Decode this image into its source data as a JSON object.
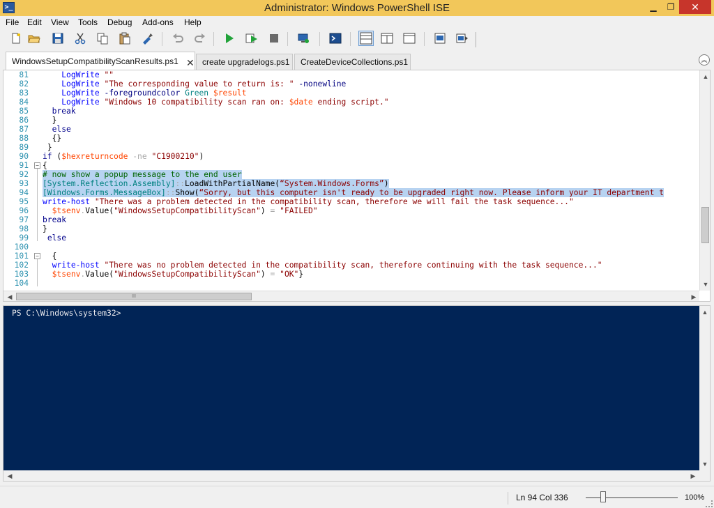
{
  "window": {
    "title": "Administrator: Windows PowerShell ISE",
    "icon_name": "powershell-icon",
    "min_glyph": "▁",
    "max_glyph": "❐",
    "close_glyph": "✕"
  },
  "menu": [
    "File",
    "Edit",
    "View",
    "Tools",
    "Debug",
    "Add-ons",
    "Help"
  ],
  "toolbar_icons": [
    "new-file-icon",
    "open-folder-icon",
    "save-icon",
    "cut-icon",
    "copy-icon",
    "paste-icon",
    "clear-console-icon",
    "undo-icon",
    "redo-icon",
    "run-script-icon",
    "run-selection-icon",
    "stop-icon",
    "remote-powershell-icon",
    "powershell-console-icon",
    "show-script-top-icon",
    "show-script-right-icon",
    "show-script-maximized-icon",
    "commands-addon-icon",
    "show-command-window-icon"
  ],
  "tabs": [
    {
      "label": "WindowsSetupCompatibilityScanResults.ps1",
      "active": true,
      "close": "✕"
    },
    {
      "label": "create upgradelogs.ps1",
      "active": false
    },
    {
      "label": "CreateDeviceCollections.ps1",
      "active": false
    }
  ],
  "collapse_glyph": "︽",
  "editor": {
    "lines": [
      {
        "n": "81",
        "indent": "    ",
        "tokens": [
          [
            "cmd",
            "LogWrite"
          ],
          [
            "txt",
            " "
          ],
          [
            "str",
            "\"\""
          ]
        ]
      },
      {
        "n": "82",
        "indent": "    ",
        "tokens": [
          [
            "cmd",
            "LogWrite"
          ],
          [
            "txt",
            " "
          ],
          [
            "str",
            "\"The corresponding value to return is: \""
          ],
          [
            "txt",
            " "
          ],
          [
            "param",
            "-nonewline"
          ]
        ]
      },
      {
        "n": "83",
        "indent": "    ",
        "tokens": [
          [
            "cmd",
            "LogWrite"
          ],
          [
            "txt",
            " "
          ],
          [
            "param",
            "-foregroundcolor"
          ],
          [
            "txt",
            " "
          ],
          [
            "type",
            "Green"
          ],
          [
            "txt",
            " "
          ],
          [
            "var",
            "$result"
          ]
        ]
      },
      {
        "n": "84",
        "indent": "    ",
        "tokens": [
          [
            "cmd",
            "LogWrite"
          ],
          [
            "txt",
            " "
          ],
          [
            "str",
            "\"Windows 10 compatibility scan ran on: "
          ],
          [
            "var",
            "$date"
          ],
          [
            "str",
            " ending script.\""
          ]
        ]
      },
      {
        "n": "85",
        "indent": "  ",
        "tokens": [
          [
            "kw",
            "break"
          ]
        ]
      },
      {
        "n": "86",
        "indent": "  ",
        "tokens": [
          [
            "txt",
            "}"
          ]
        ]
      },
      {
        "n": "87",
        "indent": "  ",
        "tokens": [
          [
            "kw",
            "else"
          ]
        ]
      },
      {
        "n": "88",
        "indent": "  ",
        "tokens": [
          [
            "txt",
            "{}"
          ]
        ]
      },
      {
        "n": "89",
        "indent": " ",
        "tokens": [
          [
            "txt",
            "}"
          ]
        ]
      },
      {
        "n": "90",
        "indent": "",
        "tokens": [
          [
            "kw",
            "if"
          ],
          [
            "txt",
            " ("
          ],
          [
            "var",
            "$hexreturncode"
          ],
          [
            "txt",
            " "
          ],
          [
            "op",
            "-ne"
          ],
          [
            "txt",
            " "
          ],
          [
            "str",
            "\"C1900210\""
          ],
          [
            "txt",
            ")"
          ]
        ]
      },
      {
        "n": "91",
        "indent": "",
        "fold": "−",
        "tokens": [
          [
            "txt",
            "{"
          ]
        ]
      },
      {
        "n": "92",
        "indent": "",
        "hl": true,
        "tokens": [
          [
            "com",
            "# now show a popup message to the end user"
          ]
        ]
      },
      {
        "n": "93",
        "indent": "",
        "hl": true,
        "tokens": [
          [
            "type",
            "[System.Reflection.Assembly]"
          ],
          [
            "op",
            "::"
          ],
          [
            "member",
            "LoadWithPartialName"
          ],
          [
            "txt",
            "("
          ],
          [
            "str",
            "“System.Windows.Forms”"
          ],
          [
            "txt",
            ")"
          ]
        ]
      },
      {
        "n": "94",
        "indent": "",
        "hl": true,
        "tokens": [
          [
            "type",
            "[Windows.Forms.MessageBox]"
          ],
          [
            "op",
            "::"
          ],
          [
            "member",
            "Show"
          ],
          [
            "txt",
            "("
          ],
          [
            "str",
            "“Sorry, but this computer isn't ready to be upgraded right now. Please inform your IT department t"
          ]
        ]
      },
      {
        "n": "95",
        "indent": "",
        "tokens": [
          [
            "cmd",
            "write-host"
          ],
          [
            "txt",
            " "
          ],
          [
            "str",
            "\"There was a problem detected in the compatibility scan, therefore we will fail the task sequence...\""
          ]
        ]
      },
      {
        "n": "96",
        "indent": "  ",
        "tokens": [
          [
            "var",
            "$tsenv"
          ],
          [
            "op",
            "."
          ],
          [
            "member",
            "Value"
          ],
          [
            "txt",
            "("
          ],
          [
            "str",
            "\"WindowsSetupCompatibilityScan\""
          ],
          [
            "txt",
            ") "
          ],
          [
            "op",
            "="
          ],
          [
            "txt",
            " "
          ],
          [
            "str",
            "\"FAILED\""
          ]
        ]
      },
      {
        "n": "97",
        "indent": "",
        "tokens": [
          [
            "kw",
            "break"
          ]
        ]
      },
      {
        "n": "98",
        "indent": "",
        "tokens": [
          [
            "txt",
            "}"
          ]
        ]
      },
      {
        "n": "99",
        "indent": " ",
        "tokens": [
          [
            "kw",
            "else"
          ]
        ]
      },
      {
        "n": "100",
        "indent": "",
        "tokens": []
      },
      {
        "n": "101",
        "indent": "  ",
        "fold": "−",
        "tokens": [
          [
            "txt",
            "{"
          ]
        ]
      },
      {
        "n": "102",
        "indent": "  ",
        "tokens": [
          [
            "cmd",
            "write-host"
          ],
          [
            "txt",
            " "
          ],
          [
            "str",
            "\"There was no problem detected in the compatibility scan, therefore continuing with the task sequence...\""
          ]
        ]
      },
      {
        "n": "103",
        "indent": "  ",
        "tokens": [
          [
            "var",
            "$tsenv"
          ],
          [
            "op",
            "."
          ],
          [
            "member",
            "Value"
          ],
          [
            "txt",
            "("
          ],
          [
            "str",
            "\"WindowsSetupCompatibilityScan\""
          ],
          [
            "txt",
            ") "
          ],
          [
            "op",
            "="
          ],
          [
            "txt",
            " "
          ],
          [
            "str",
            "\"OK\""
          ],
          [
            "txt",
            "}"
          ]
        ]
      },
      {
        "n": "104",
        "indent": "",
        "tokens": []
      }
    ],
    "scroll_up": "▲",
    "scroll_down": "▼",
    "scroll_left": "◀",
    "scroll_right": "▶",
    "thumb_grip": "III"
  },
  "console": {
    "prompt": "PS C:\\Windows\\system32>"
  },
  "status": {
    "position": "Ln 94  Col 336",
    "zoom": "100%",
    "zoom_level": 1.0
  }
}
